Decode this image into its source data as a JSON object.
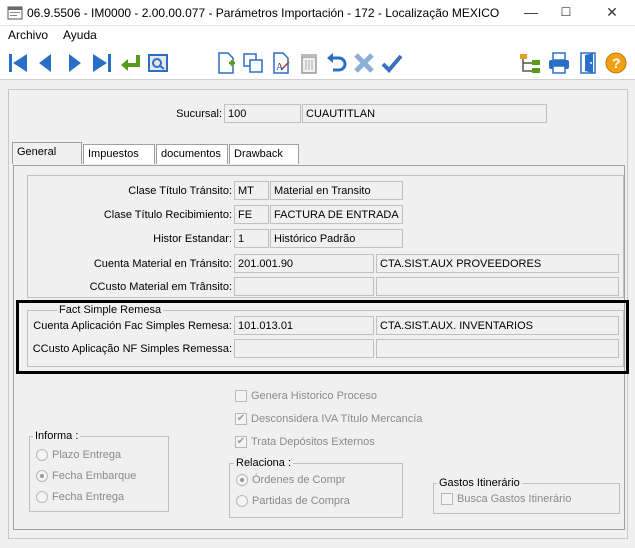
{
  "window": {
    "title": "06.9.5506 - IM0000 - 2.00.00.077 - Parámetros Importación - 172 - Localização MEXICO",
    "minimize": "—",
    "maximize": "☐",
    "close": "✕"
  },
  "menu": {
    "file": "Archivo",
    "help": "Ayuda"
  },
  "header": {
    "sucursal_label": "Sucursal:",
    "sucursal_code": "100",
    "sucursal_name": "CUAUTITLAN"
  },
  "tabs": [
    {
      "label": "General"
    },
    {
      "label": "Impuestos"
    },
    {
      "label": "documentos"
    },
    {
      "label": "Drawback"
    }
  ],
  "general": {
    "clase_titulo_transito": {
      "label": "Clase Título Tránsito:",
      "code": "MT",
      "desc": "Material en Transito"
    },
    "clase_titulo_recibimiento": {
      "label": "Clase Título Recibimiento:",
      "code": "FE",
      "desc": "FACTURA DE ENTRADA"
    },
    "histor_estandar": {
      "label": "Histor Estandar:",
      "code": "1",
      "desc": "Histórico Padrão"
    },
    "cuenta_material_transito": {
      "label": "Cuenta Material en Tránsito:",
      "code": "201.001.90",
      "desc": "CTA.SIST.AUX PROVEEDORES"
    },
    "ccusto_material_transito": {
      "label": "CCusto Material em Trânsito:",
      "code": "",
      "desc": ""
    }
  },
  "fact_simple": {
    "title": "Fact Simple Remesa",
    "cuenta": {
      "label": "Cuenta Aplicación Fac Simples Remesa:",
      "code": "101.013.01",
      "desc": "CTA.SIST.AUX. INVENTARIOS"
    },
    "ccusto": {
      "label": "CCusto Aplicação NF Simples Remessa:",
      "code": "",
      "desc": ""
    }
  },
  "checkboxes": [
    {
      "label": "Genera Historico Proceso",
      "checked": ""
    },
    {
      "label": "Desconsidera IVA Título Mercancía",
      "checked": "✔"
    },
    {
      "label": "Trata Depósitos Externos",
      "checked": "✔"
    }
  ],
  "informa": {
    "title": "Informa :",
    "options": [
      "Plazo Entrega",
      "Fecha  Embarque",
      "Fecha  Entrega"
    ]
  },
  "relaciona": {
    "title": "Relaciona :",
    "options": [
      "Órdenes de Compr",
      "Partidas de Compra"
    ]
  },
  "gastos": {
    "title": "Gastos Itinerário",
    "checkbox": "Busca Gastos Itinerário"
  }
}
